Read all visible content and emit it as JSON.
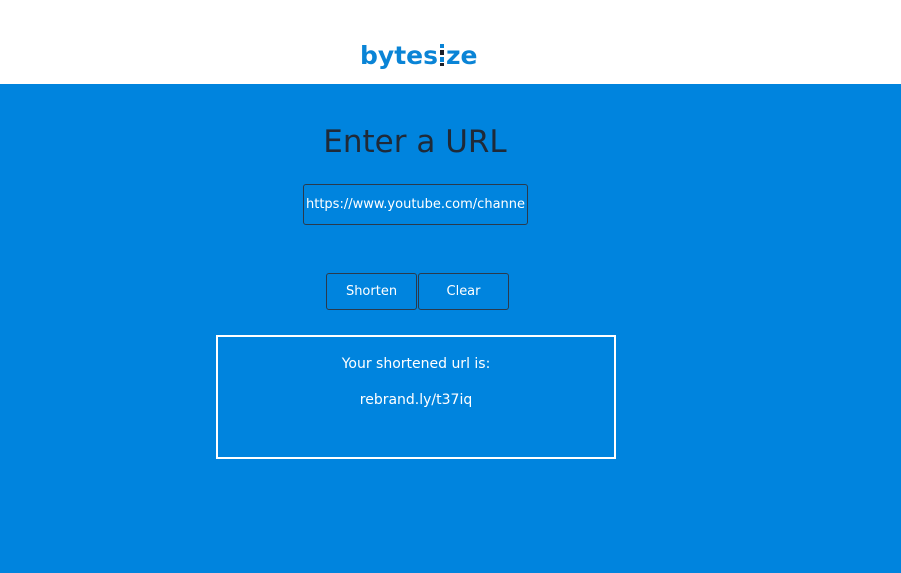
{
  "header": {
    "logo_prefix": "bytes",
    "logo_suffix": "ze",
    "logo_text": "bytesize"
  },
  "form": {
    "title": "Enter a URL",
    "url_value": "https://www.youtube.com/channel/U",
    "shorten_label": "Shorten",
    "clear_label": "Clear"
  },
  "result": {
    "label": "Your shortened url is:",
    "short_url": "rebrand.ly/t37iq"
  },
  "colors": {
    "brand_blue": "#0084de",
    "logo_blue": "#0a84d6",
    "title_text": "#1f2a38",
    "header_bg": "#ffffff"
  }
}
